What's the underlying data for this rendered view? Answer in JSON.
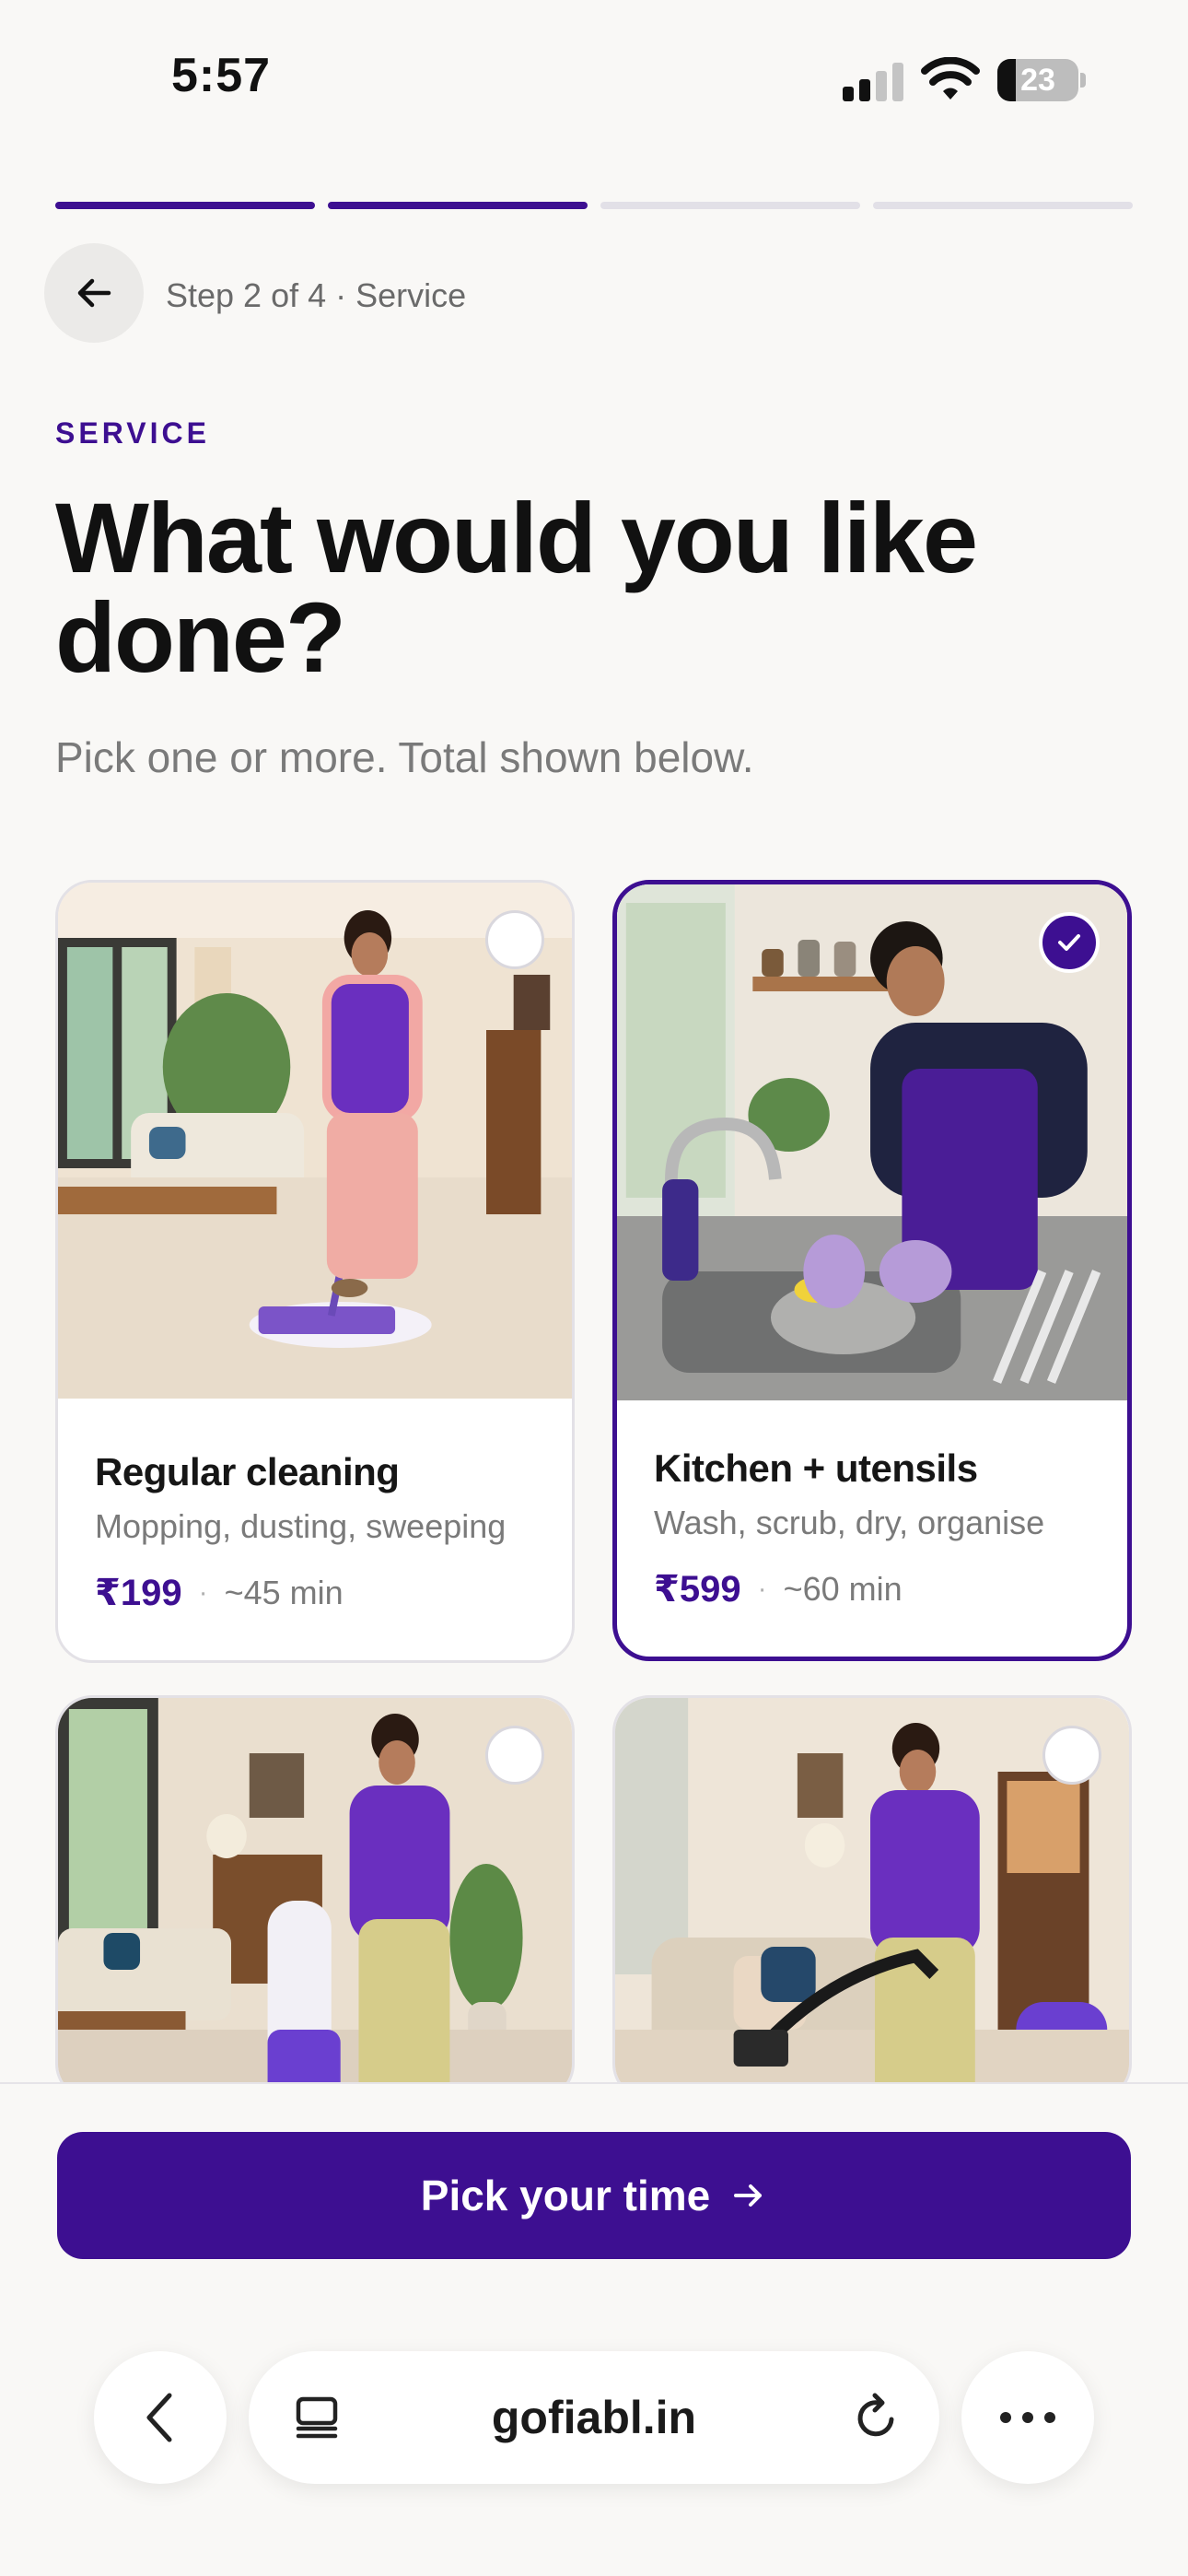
{
  "status_bar": {
    "time": "5:57",
    "battery_level": 23,
    "battery_text": "23"
  },
  "progress": {
    "total_steps": 4,
    "current_step": 2
  },
  "header": {
    "step_label": "Step 2 of 4 · Service"
  },
  "eyebrow": "SERVICE",
  "title": "What would you like done?",
  "subtitle": "Pick one or more. Total shown below.",
  "colors": {
    "brand": "#3d0f91",
    "background": "#f9f8f6"
  },
  "services": [
    {
      "title": "Regular cleaning",
      "description": "Mopping, dusting, sweeping",
      "price": "₹199",
      "duration": "~45 min",
      "selected": false
    },
    {
      "title": "Kitchen + utensils",
      "description": "Wash, scrub, dry, organise",
      "price": "₹599",
      "duration": "~60 min",
      "selected": true
    },
    {
      "selected": false
    },
    {
      "selected": false
    }
  ],
  "cta": {
    "label": "Pick your time"
  },
  "browser": {
    "url": "gofiabl.in"
  }
}
